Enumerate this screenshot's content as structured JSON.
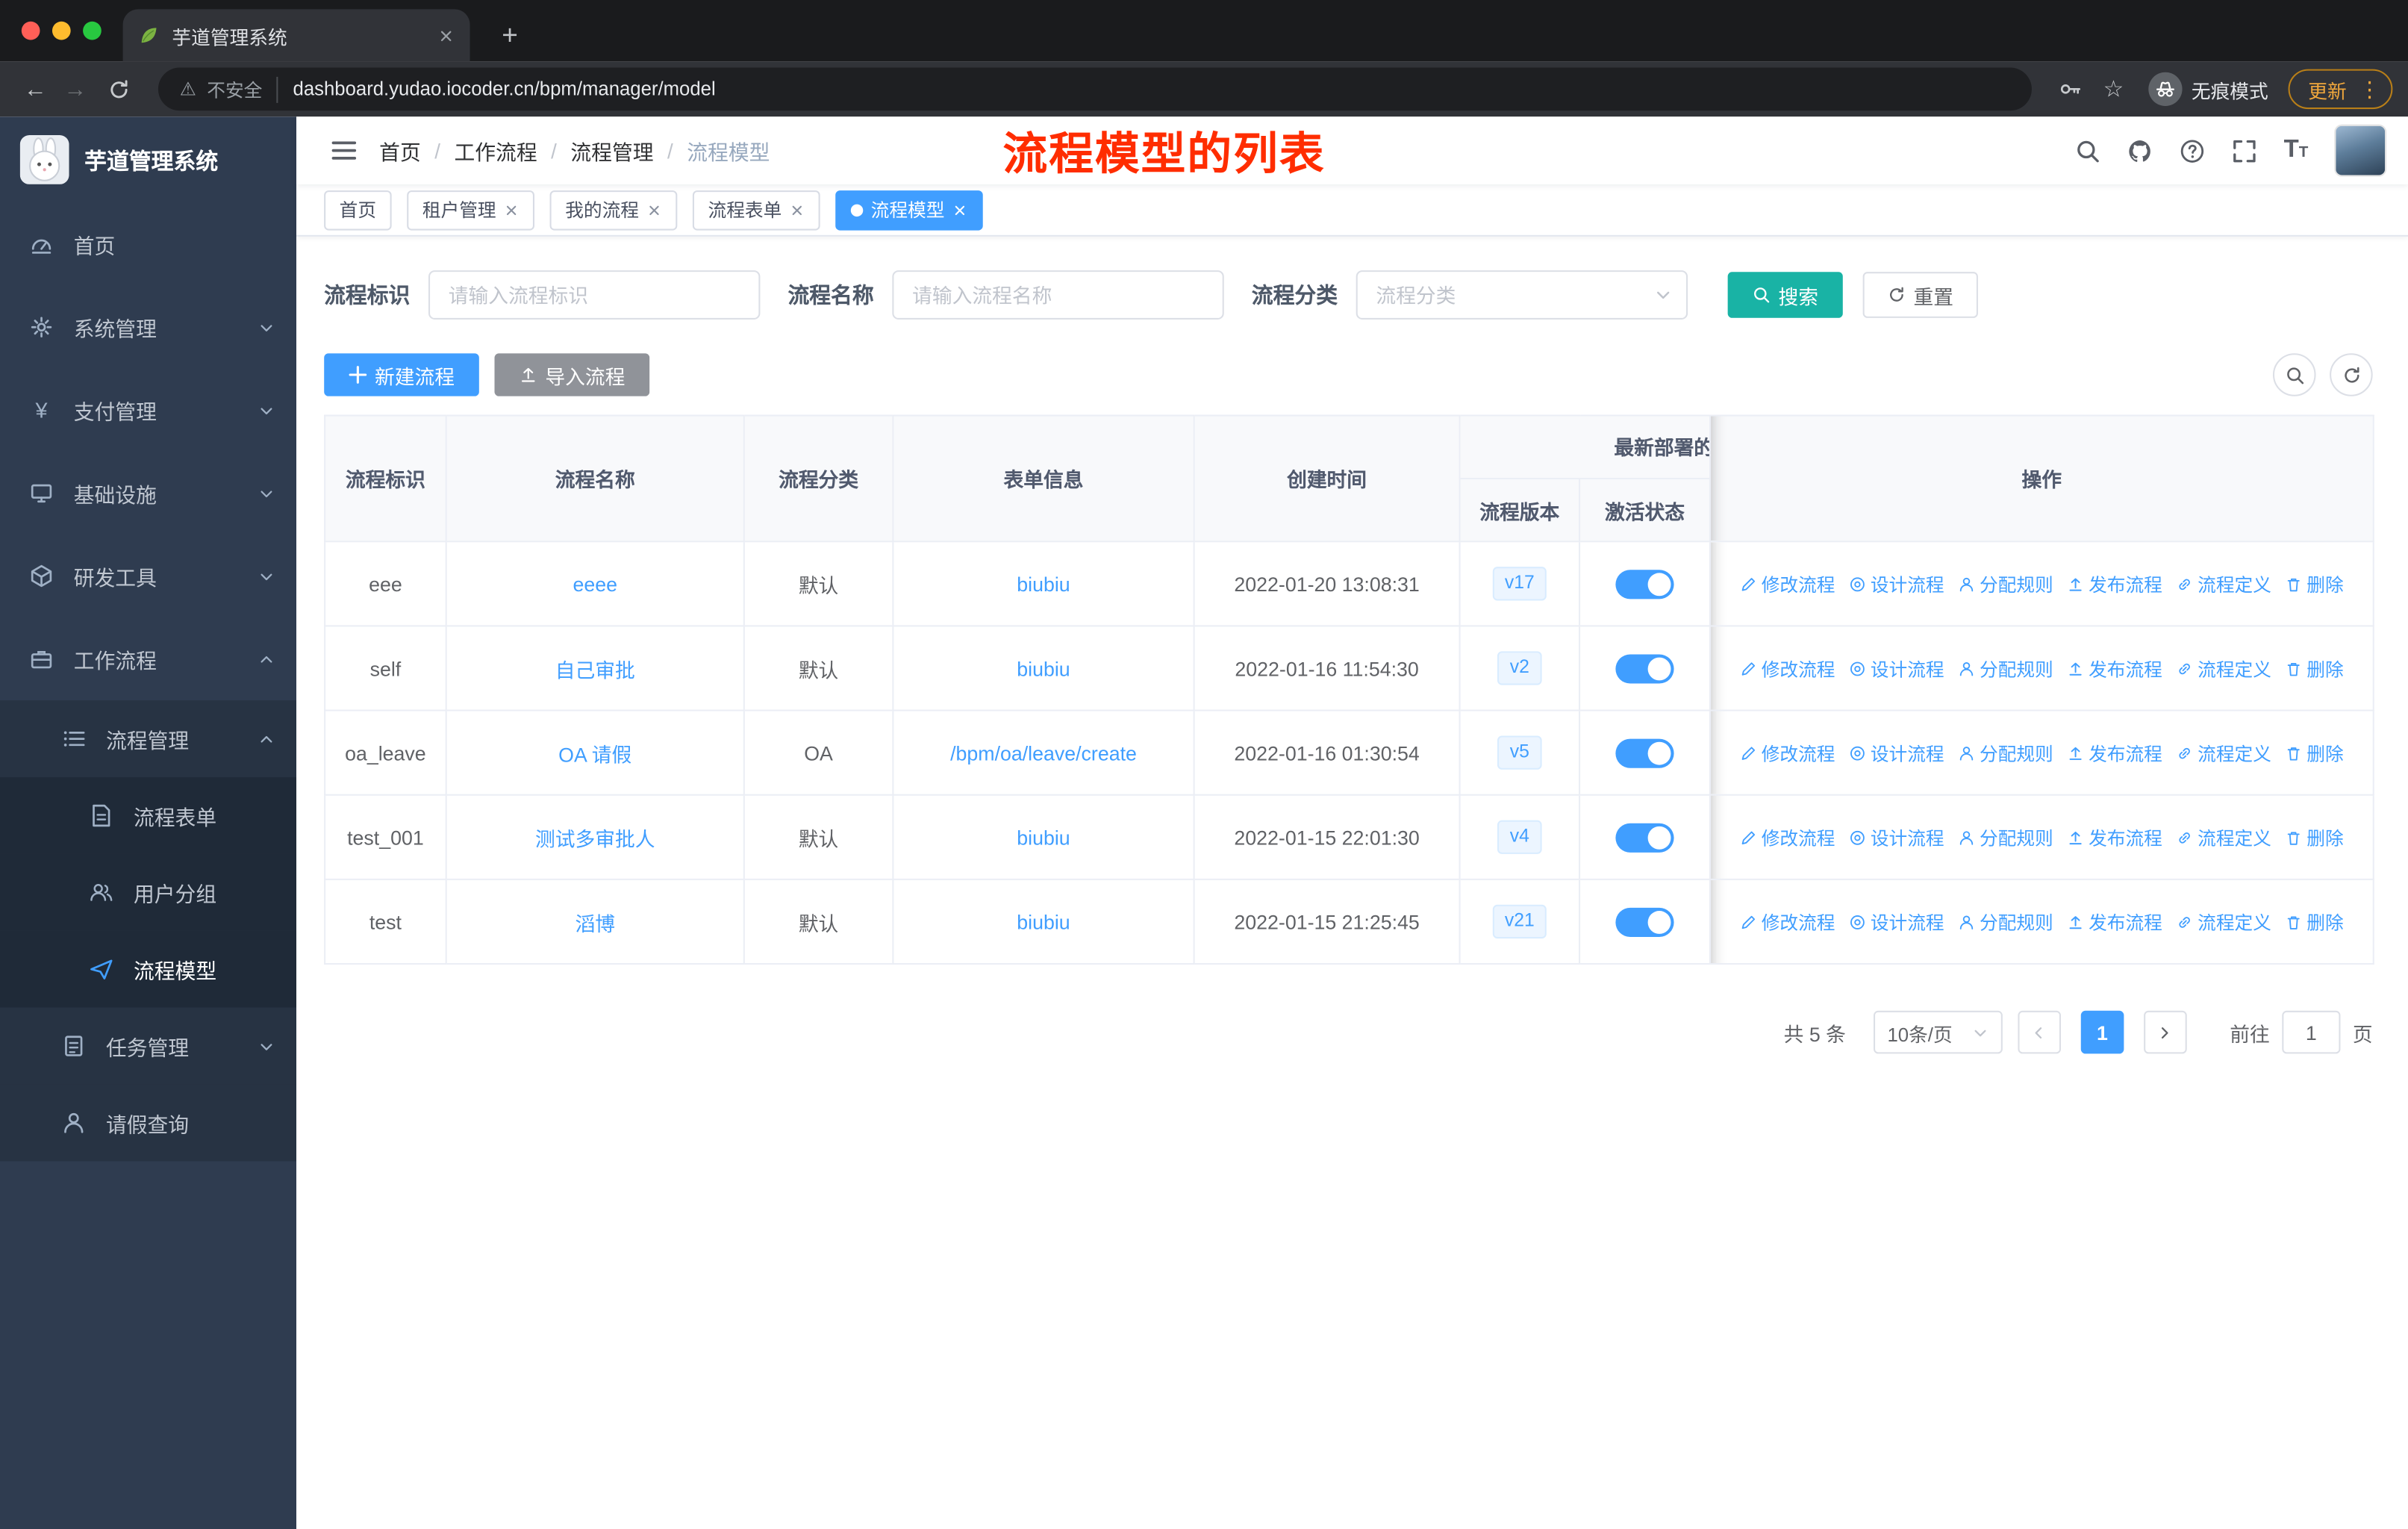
{
  "colors": {
    "accent_blue": "#409eff",
    "search_button_teal": "#19b3a5",
    "import_button_gray": "#909399",
    "annotation_red": "#ff2d00",
    "sidebar_bg": "#2f3c50",
    "toggle_on_blue": "#409eff",
    "update_chip_orange": "#f0a73c"
  },
  "browser": {
    "tab_title": "芋道管理系统",
    "security_label": "不安全",
    "url": "dashboard.yudao.iocoder.cn/bpm/manager/model",
    "incognito_label": "无痕模式",
    "update_label": "更新"
  },
  "sidebar": {
    "logo_title": "芋道管理系统",
    "items": [
      {
        "label": "首页"
      },
      {
        "label": "系统管理"
      },
      {
        "label": "支付管理"
      },
      {
        "label": "基础设施"
      },
      {
        "label": "研发工具"
      },
      {
        "label": "工作流程"
      }
    ],
    "workflow_submenu": {
      "process_management": {
        "label": "流程管理",
        "children": [
          {
            "label": "流程表单"
          },
          {
            "label": "用户分组"
          },
          {
            "label": "流程模型"
          }
        ]
      },
      "task_management": {
        "label": "任务管理"
      },
      "leave_query": {
        "label": "请假查询"
      }
    }
  },
  "header": {
    "breadcrumb": [
      "首页",
      "工作流程",
      "流程管理",
      "流程模型"
    ],
    "annotation": "流程模型的列表"
  },
  "tags": [
    {
      "label": "首页"
    },
    {
      "label": "租户管理"
    },
    {
      "label": "我的流程"
    },
    {
      "label": "流程表单"
    },
    {
      "label": "流程模型"
    }
  ],
  "filters": {
    "id_label": "流程标识",
    "id_placeholder": "请输入流程标识",
    "name_label": "流程名称",
    "name_placeholder": "请输入流程名称",
    "category_label": "流程分类",
    "category_placeholder": "流程分类",
    "search_label": "搜索",
    "reset_label": "重置"
  },
  "toolbar": {
    "create_label": "新建流程",
    "import_label": "导入流程"
  },
  "table": {
    "columns": {
      "id": "流程标识",
      "name": "流程名称",
      "category": "流程分类",
      "form": "表单信息",
      "created": "创建时间",
      "deploy_group": "最新部署的",
      "version": "流程版本",
      "status": "激活状态",
      "actions": "操作"
    },
    "action_labels": [
      "修改流程",
      "设计流程",
      "分配规则",
      "发布流程",
      "流程定义",
      "删除"
    ],
    "rows": [
      {
        "id": "eee",
        "name": "eeee",
        "category": "默认",
        "form": "biubiu",
        "created": "2022-01-20 13:08:31",
        "version": "v17",
        "active": true
      },
      {
        "id": "self",
        "name": "自己审批",
        "category": "默认",
        "form": "biubiu",
        "created": "2022-01-16 11:54:30",
        "version": "v2",
        "active": true
      },
      {
        "id": "oa_leave",
        "name": "OA 请假",
        "category": "OA",
        "form": "/bpm/oa/leave/create",
        "created": "2022-01-16 01:30:54",
        "version": "v5",
        "active": true
      },
      {
        "id": "test_001",
        "name": "测试多审批人",
        "category": "默认",
        "form": "biubiu",
        "created": "2022-01-15 22:01:30",
        "version": "v4",
        "active": true
      },
      {
        "id": "test",
        "name": "滔博",
        "category": "默认",
        "form": "biubiu",
        "created": "2022-01-15 21:25:45",
        "version": "v21",
        "active": true
      }
    ]
  },
  "pagination": {
    "total_label": "共 5 条",
    "page_size_label": "10条/页",
    "current_page": "1",
    "goto_label": "前往",
    "goto_value": "1",
    "page_unit_label": "页"
  }
}
